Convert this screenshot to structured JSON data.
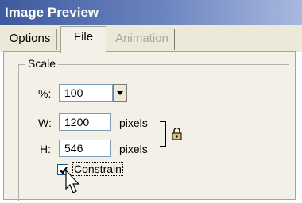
{
  "window": {
    "title": "Image Preview"
  },
  "tabs": [
    {
      "label": "Options",
      "state": "inactive"
    },
    {
      "label": "File",
      "state": "active"
    },
    {
      "label": "Animation",
      "state": "disabled"
    }
  ],
  "scale": {
    "group_label": "Scale",
    "percent": {
      "label": "%:",
      "value": "100"
    },
    "width": {
      "label": "W:",
      "value": "1200",
      "unit": "pixels"
    },
    "height": {
      "label": "H:",
      "value": "546",
      "unit": "pixels"
    },
    "lock_icon": "lock-icon",
    "constrain": {
      "label": "Constrain",
      "checked": true
    }
  },
  "cursor_icon": "arrow-pointer-icon",
  "colors": {
    "titlebar_start": "#3e5a9e",
    "titlebar_end": "#a9b9e0",
    "panel": "#f3f1e7",
    "input_border": "#7f9db9",
    "disabled_text": "#a9a79c"
  }
}
